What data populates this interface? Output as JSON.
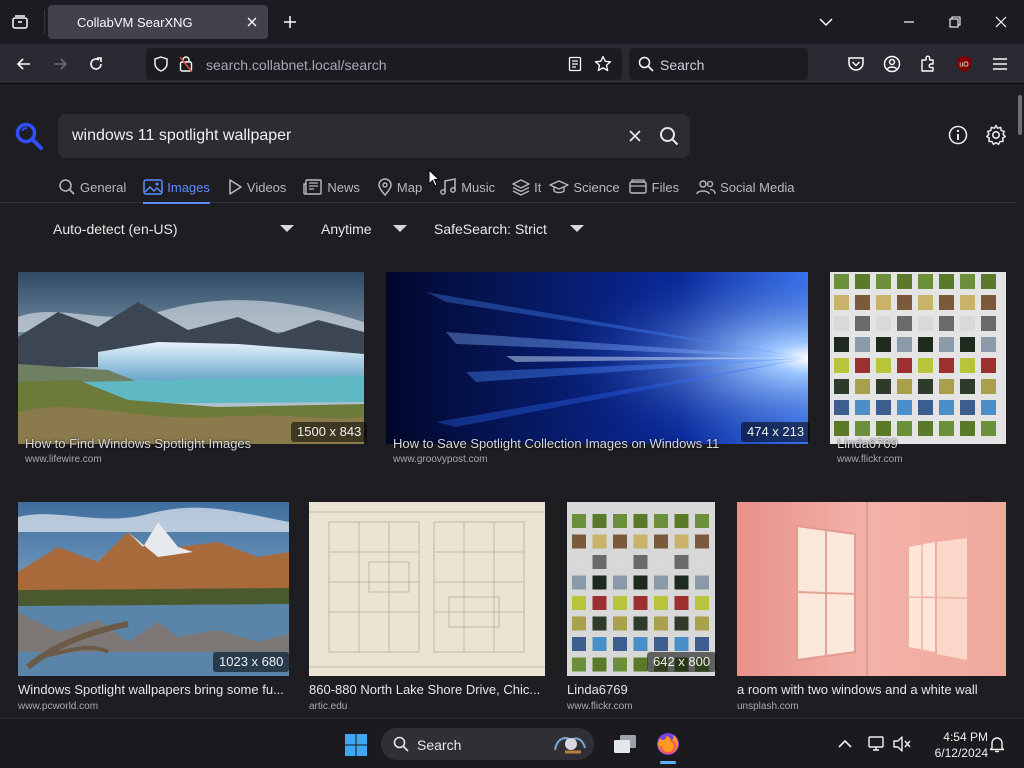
{
  "browser": {
    "tab_title": "CollabVM SearXNG",
    "url_host": "search.collabnet.local",
    "url_path": "/search",
    "web_search_placeholder": "Search"
  },
  "searx": {
    "query": "windows 11 spotlight wallpaper",
    "categories": [
      {
        "label": "General",
        "icon": "search-icon"
      },
      {
        "label": "Images",
        "icon": "image-icon"
      },
      {
        "label": "Videos",
        "icon": "play-icon"
      },
      {
        "label": "News",
        "icon": "newspaper-icon"
      },
      {
        "label": "Map",
        "icon": "map-pin-icon"
      },
      {
        "label": "Music",
        "icon": "music-note-icon"
      },
      {
        "label": "It",
        "icon": "layers-icon"
      },
      {
        "label": "Science",
        "icon": "graduation-cap-icon"
      },
      {
        "label": "Files",
        "icon": "files-icon"
      },
      {
        "label": "Social Media",
        "icon": "people-icon"
      }
    ],
    "active_category": "Images",
    "filters": {
      "language": "Auto-detect (en-US)",
      "time": "Anytime",
      "safesearch": "SafeSearch: Strict"
    },
    "results": [
      {
        "title": "How to Find Windows Spotlight Images",
        "source": "www.lifewire.com",
        "size": "1500 x 843"
      },
      {
        "title": "How to Save Spotlight Collection Images on Windows 11",
        "source": "www.groovypost.com",
        "size": "474 x 213"
      },
      {
        "title": "Linda6769",
        "source": "www.flickr.com",
        "size": ""
      },
      {
        "title": "Windows Spotlight wallpapers bring some fu...",
        "source": "www.pcworld.com",
        "size": "1023 x 680"
      },
      {
        "title": "860-880 North Lake Shore Drive, Chic...",
        "source": "artic.edu",
        "size": ""
      },
      {
        "title": "Linda6769",
        "source": "www.flickr.com",
        "size": "642 x 800"
      },
      {
        "title": "a room with two windows and a white wall",
        "source": "unsplash.com",
        "size": ""
      }
    ]
  },
  "taskbar": {
    "search_label": "Search",
    "time": "4:54 PM",
    "date": "6/12/2024"
  }
}
